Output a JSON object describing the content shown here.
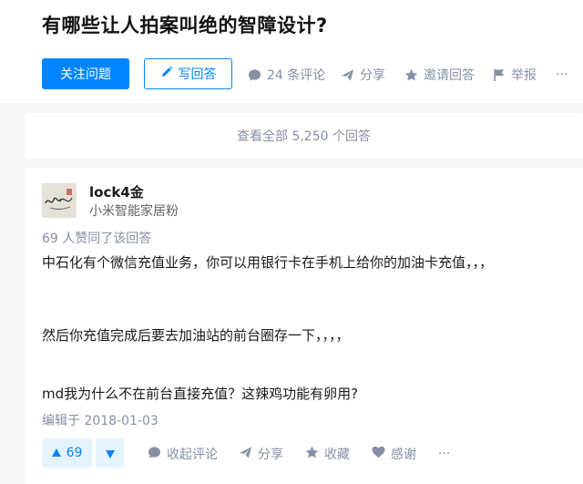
{
  "question": {
    "title": "有哪些让人拍案叫绝的智障设计?",
    "follow_label": "关注问题",
    "write_label": "写回答",
    "actions": {
      "comments": "24 条评论",
      "share": "分享",
      "invite": "邀请回答",
      "report": "举报",
      "more": "···"
    }
  },
  "view_all": "查看全部 5,250 个回答",
  "answer": {
    "author_name": "lock4金",
    "author_bio": "小米智能家居粉",
    "vote_summary": "69 人赞同了该回答",
    "paragraphs": [
      "中石化有个微信充值业务，你可以用银行卡在手机上给你的加油卡充值，，，",
      "然后你充值完成后要去加油站的前台圈存一下，，，，",
      "md我为什么不在前台直接充值？这辣鸡功能有卵用?"
    ],
    "edited": "编辑于 2018-01-03",
    "upvotes": "69",
    "actions": {
      "collapse_comments": "收起评论",
      "share": "分享",
      "favorite": "收藏",
      "thanks": "感谢",
      "more": "···"
    }
  },
  "colors": {
    "accent": "#0084ff",
    "muted": "#8590a6",
    "background": "#f6f6f6"
  },
  "icons": [
    "pencil-icon",
    "comment-icon",
    "share-plane-icon",
    "star-icon",
    "flag-icon",
    "more-icon",
    "triangle-up-icon",
    "triangle-down-icon",
    "heart-icon"
  ]
}
